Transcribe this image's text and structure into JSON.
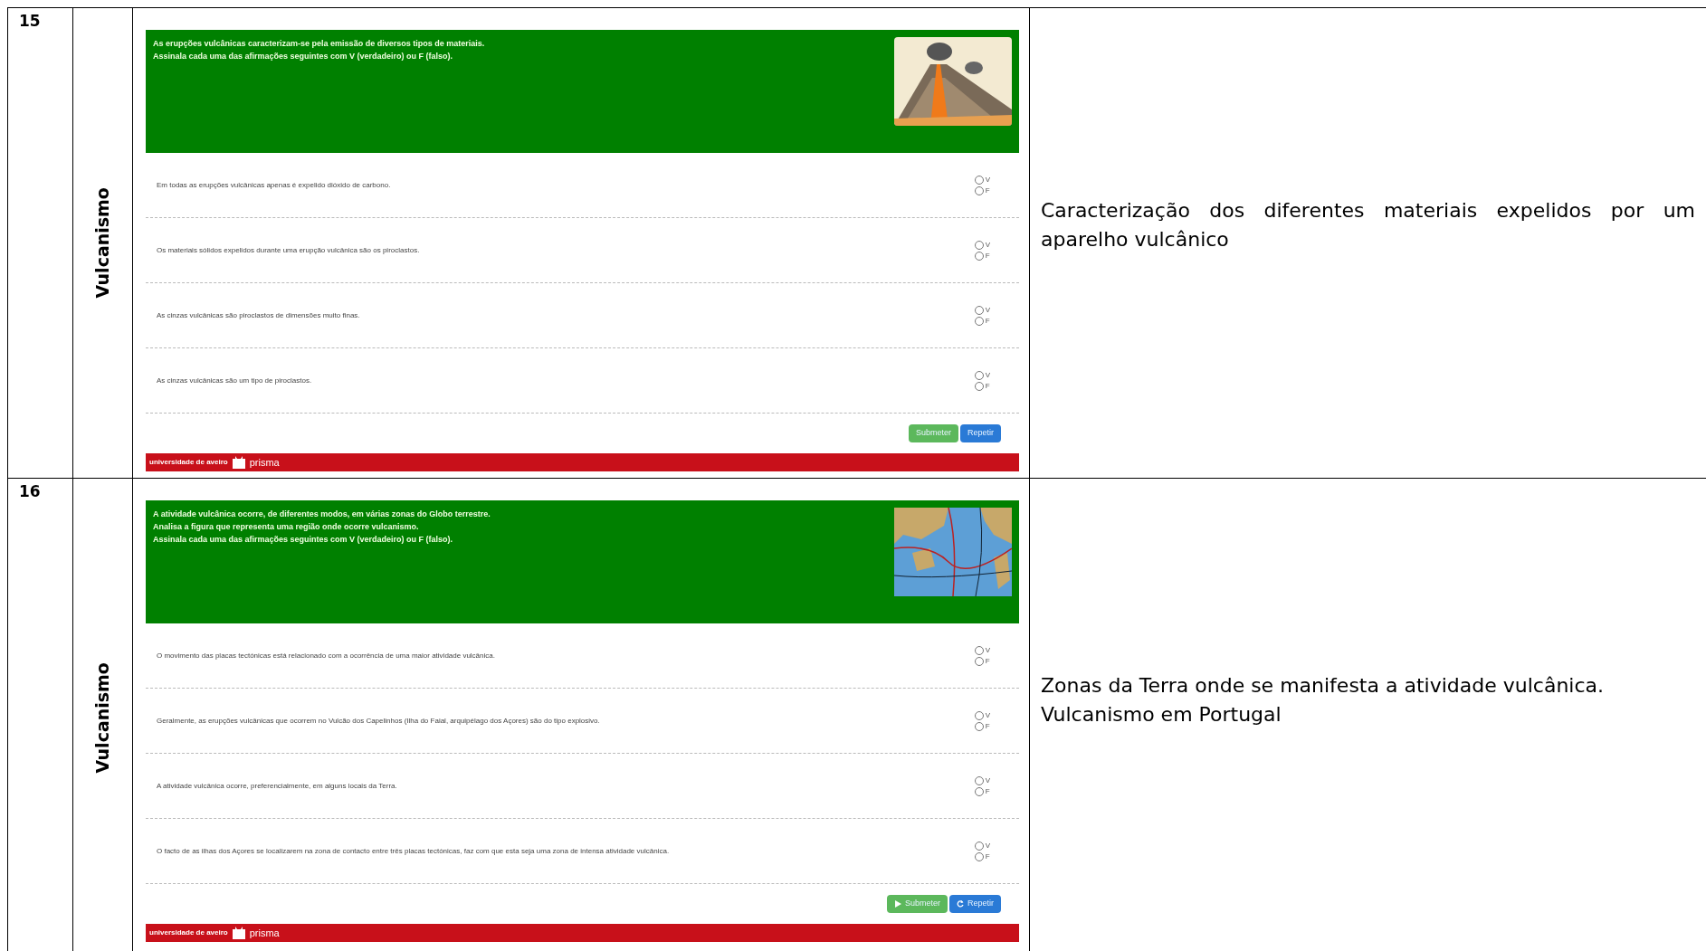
{
  "rows": [
    {
      "number": "15",
      "topic": "Vulcanismo",
      "exercise": {
        "kind": "volcano",
        "intro": [
          "As erupções vulcânicas caracterizam-se pela emissão de diversos tipos de materiais.",
          "Assinala cada uma das afirmações seguintes com V (verdadeiro) ou F (falso)."
        ],
        "questions": [
          {
            "text": "Em todas as erupções vulcânicas apenas é expelido dióxido de carbono.",
            "options": [
              {
                "label": "V",
                "selected": false
              },
              {
                "label": "F",
                "selected": false
              }
            ]
          },
          {
            "text": "Os materiais sólidos expelidos durante uma erupção vulcânica são os piroclastos.",
            "options": [
              {
                "label": "V",
                "selected": false
              },
              {
                "label": "F",
                "selected": false
              }
            ]
          },
          {
            "text": "As cinzas vulcânicas são piroclastos de dimensões muito finas.",
            "options": [
              {
                "label": "V",
                "selected": false
              },
              {
                "label": "F",
                "selected": false
              }
            ]
          },
          {
            "text": "As cinzas vulcânicas são um tipo de piroclastos.",
            "options": [
              {
                "label": "V",
                "selected": false
              },
              {
                "label": "F",
                "selected": false
              }
            ]
          }
        ],
        "buttons": [
          {
            "label": "Submeter",
            "kind": "submit",
            "icon": false
          },
          {
            "label": "Repetir",
            "kind": "repeat",
            "icon": false
          }
        ],
        "footer": {
          "institution": "universidade de aveiro",
          "brand": "prisma"
        }
      },
      "description": [
        "Caracterização dos diferentes materiais expelidos por um aparelho vulcânico"
      ]
    },
    {
      "number": "16",
      "topic": "Vulcanismo",
      "exercise": {
        "kind": "map",
        "intro": [
          "A atividade vulcânica ocorre, de diferentes modos, em várias zonas do Globo terrestre.",
          "Analisa a figura que representa uma região onde ocorre vulcanismo.",
          "Assinala cada uma das afirmações seguintes com V (verdadeiro) ou F (falso)."
        ],
        "questions": [
          {
            "text": "O movimento das placas tectónicas está relacionado com a ocorrência de uma maior atividade vulcânica.",
            "options": [
              {
                "label": "V",
                "selected": false
              },
              {
                "label": "F",
                "selected": false
              }
            ]
          },
          {
            "text": "Geralmente, as erupções vulcânicas que ocorrem no Vulcão dos Capelinhos (Ilha do Faial, arquipélago dos Açores) são do tipo explosivo.",
            "options": [
              {
                "label": "V",
                "selected": false
              },
              {
                "label": "F",
                "selected": false
              }
            ]
          },
          {
            "text": "A atividade vulcânica ocorre, preferencialmente, em alguns locais da Terra.",
            "options": [
              {
                "label": "V",
                "selected": false
              },
              {
                "label": "F",
                "selected": false
              }
            ]
          },
          {
            "text": "O facto de as ilhas dos Açores se localizarem na zona de contacto entre três placas tectónicas, faz com que esta seja uma zona de intensa atividade vulcânica.",
            "options": [
              {
                "label": "V",
                "selected": false
              },
              {
                "label": "F",
                "selected": false
              }
            ]
          }
        ],
        "buttons": [
          {
            "label": "Submeter",
            "kind": "submit",
            "icon": true
          },
          {
            "label": "Repetir",
            "kind": "repeat",
            "icon": true
          }
        ],
        "footer": {
          "institution": "universidade de aveiro",
          "brand": "prisma"
        }
      },
      "description": [
        "Zonas da Terra onde se manifesta a atividade vulcânica.",
        "Vulcanismo em Portugal"
      ]
    }
  ]
}
